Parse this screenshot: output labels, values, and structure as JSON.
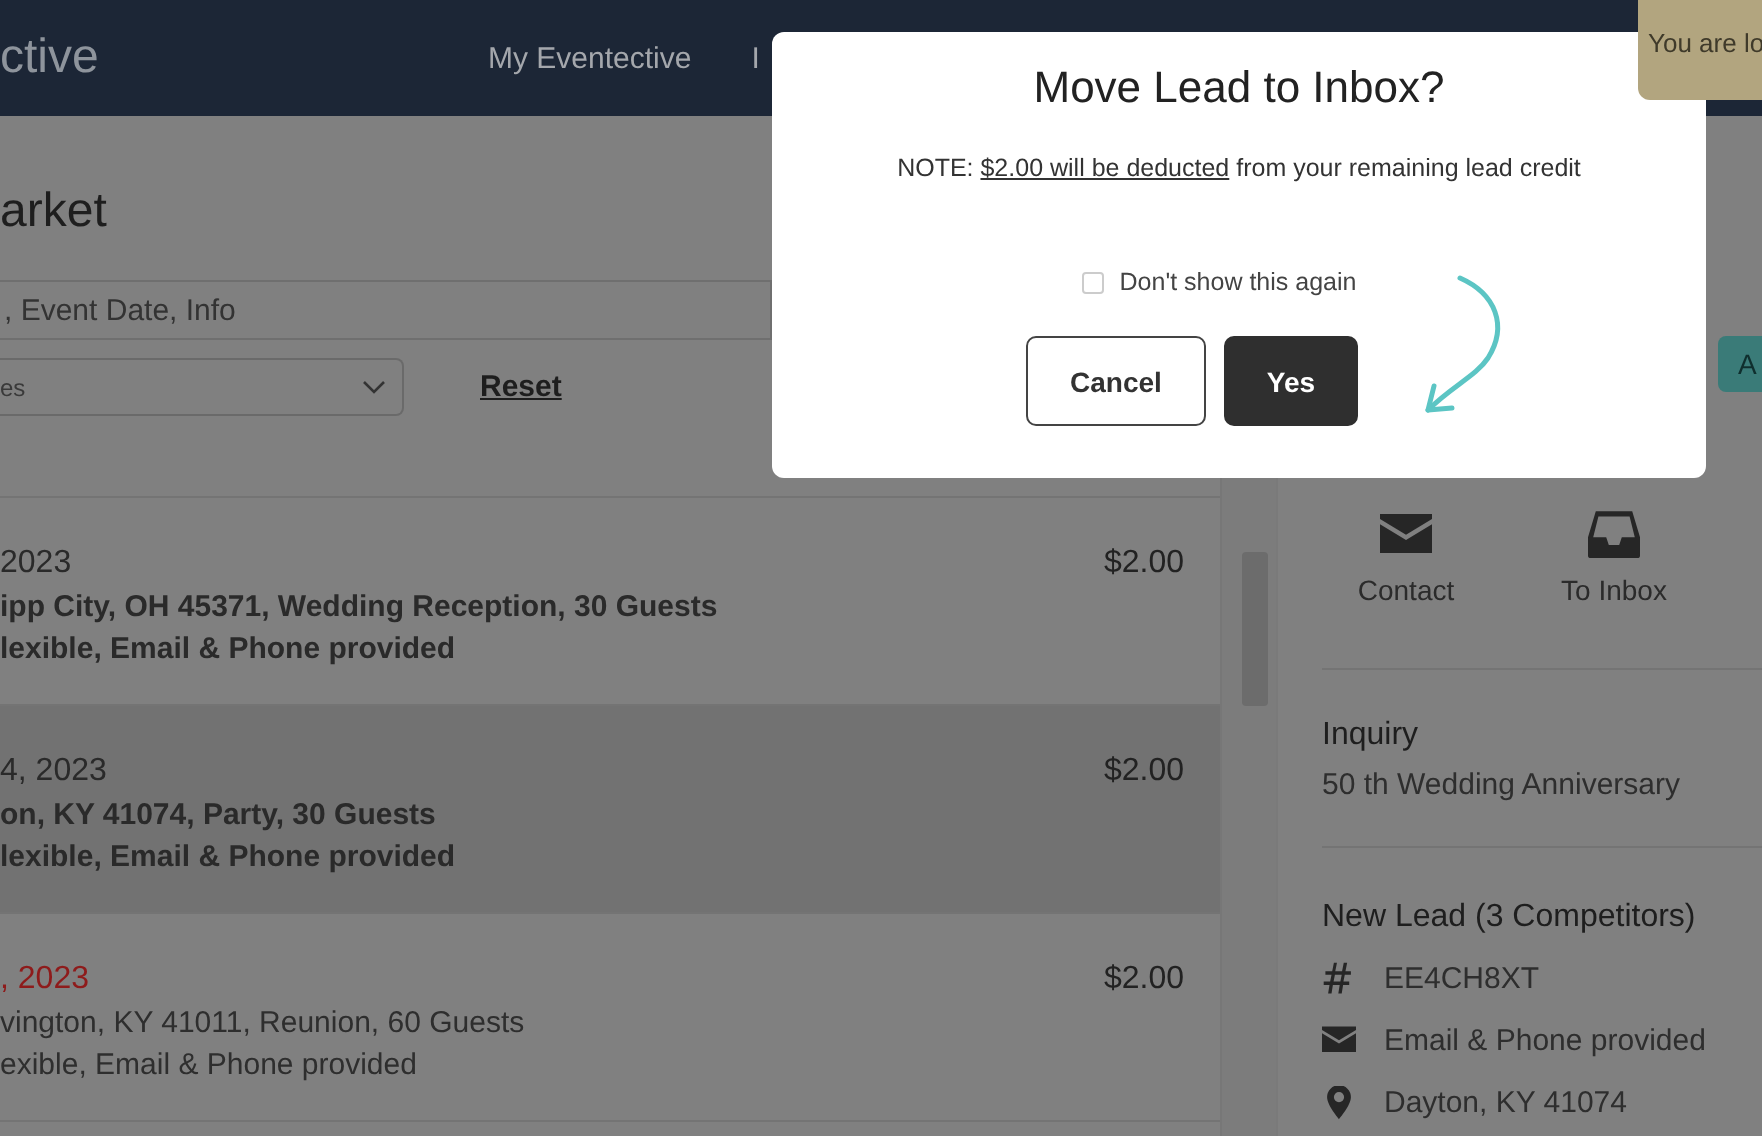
{
  "header": {
    "logo": "ctive",
    "nav": [
      "My Eventective",
      "I"
    ]
  },
  "toast": {
    "text": "You are lo"
  },
  "market": {
    "title": "arket",
    "search": {
      "placeholder": ", Event Date, Info"
    },
    "filter": {
      "value": "es"
    },
    "reset": "Reset"
  },
  "leads": [
    {
      "date": "2023",
      "location": "ipp City, OH 45371, Wedding Reception, 30 Guests",
      "details": "lexible, Email & Phone provided",
      "price": "$2.00",
      "unread": true,
      "selected": false,
      "expired": false
    },
    {
      "date": "4, 2023",
      "location": "on, KY 41074, Party, 30 Guests",
      "details": "lexible, Email & Phone provided",
      "price": "$2.00",
      "unread": true,
      "selected": true,
      "expired": false
    },
    {
      "date": ", 2023",
      "location": "vington, KY 41011, Reunion, 60 Guests",
      "details": "exible, Email & Phone provided",
      "price": "$2.00",
      "unread": false,
      "selected": false,
      "expired": true
    }
  ],
  "detail": {
    "action_button": "A",
    "actions": [
      {
        "kind": "envelope",
        "label": "Contact"
      },
      {
        "kind": "inbox",
        "label": "To Inbox"
      }
    ],
    "inquiry": {
      "heading": "Inquiry",
      "text": "50 th Wedding Anniversary"
    },
    "lead": {
      "heading": "New Lead (3 Competitors)",
      "items": [
        {
          "kind": "hash",
          "text": "EE4CH8XT"
        },
        {
          "kind": "envelope",
          "text": "Email & Phone provided"
        },
        {
          "kind": "pin",
          "text": "Dayton, KY 41074"
        }
      ]
    }
  },
  "modal": {
    "title": "Move Lead to Inbox?",
    "note": {
      "prefix": "NOTE:",
      "link": "$2.00 will be deducted",
      "suffix": "from your remaining lead credit"
    },
    "checkbox": {
      "label": "Don't show this again",
      "checked": false
    },
    "buttons": [
      {
        "kind": "secondary",
        "label": "Cancel"
      },
      {
        "kind": "primary",
        "label": "Yes"
      }
    ]
  }
}
